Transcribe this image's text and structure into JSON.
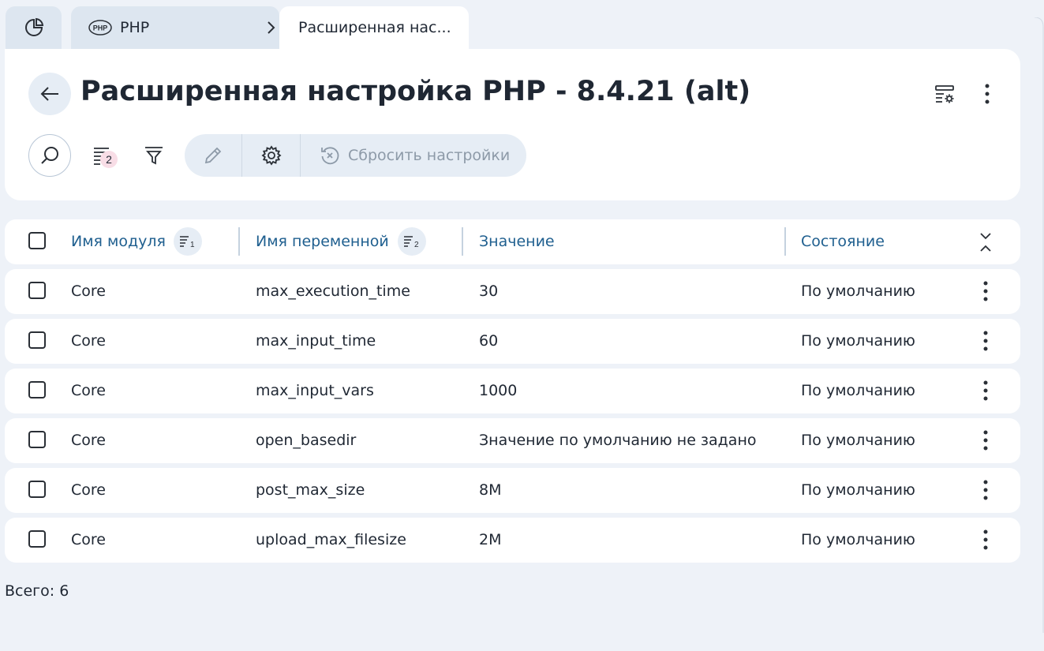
{
  "tabs": {
    "home_icon": "dashboard-pie-icon",
    "php": {
      "logo": "PHP",
      "label": "PHP"
    },
    "active": {
      "label": "Расширенная нас..."
    }
  },
  "header": {
    "title": "Расширенная настройка PHP - 8.4.21 (alt)",
    "badge_count": "2",
    "reset_label": "Сбросить настройки"
  },
  "table": {
    "columns": [
      {
        "label": "Имя модуля",
        "sort_order": "1"
      },
      {
        "label": "Имя переменной",
        "sort_order": "2"
      },
      {
        "label": "Значение"
      },
      {
        "label": "Состояние"
      }
    ],
    "rows": [
      {
        "module": "Core",
        "variable": "max_execution_time",
        "value": "30",
        "state": "По умолчанию"
      },
      {
        "module": "Core",
        "variable": "max_input_time",
        "value": "60",
        "state": "По умолчанию"
      },
      {
        "module": "Core",
        "variable": "max_input_vars",
        "value": "1000",
        "state": "По умолчанию"
      },
      {
        "module": "Core",
        "variable": "open_basedir",
        "value": "Значение по умолчанию не задано",
        "state": "По умолчанию"
      },
      {
        "module": "Core",
        "variable": "post_max_size",
        "value": "8M",
        "state": "По умолчанию"
      },
      {
        "module": "Core",
        "variable": "upload_max_filesize",
        "value": "2M",
        "state": "По умолчанию"
      }
    ]
  },
  "footer": {
    "total": "Всего: 6"
  },
  "colors": {
    "accent": "#1f5f8f",
    "background": "#eef2f8",
    "chip": "#e6edf5",
    "badge": "#f8dde6"
  }
}
